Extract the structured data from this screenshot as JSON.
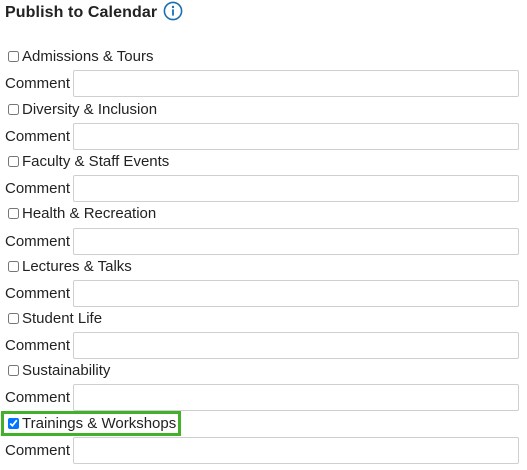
{
  "header": {
    "title": "Publish to Calendar",
    "info_icon": "info-circle-icon"
  },
  "calendars": [
    {
      "label": "Admissions & Tours",
      "checked": false,
      "comment_label": "Comment",
      "comment_value": ""
    },
    {
      "label": "Diversity & Inclusion",
      "checked": false,
      "comment_label": "Comment",
      "comment_value": ""
    },
    {
      "label": "Faculty & Staff Events",
      "checked": false,
      "comment_label": "Comment",
      "comment_value": ""
    },
    {
      "label": "Health & Recreation",
      "checked": false,
      "comment_label": "Comment",
      "comment_value": ""
    },
    {
      "label": "Lectures & Talks",
      "checked": false,
      "comment_label": "Comment",
      "comment_value": ""
    },
    {
      "label": "Student Life",
      "checked": false,
      "comment_label": "Comment",
      "comment_value": ""
    },
    {
      "label": "Sustainability",
      "checked": false,
      "comment_label": "Comment",
      "comment_value": ""
    },
    {
      "label": "Trainings & Workshops",
      "checked": true,
      "comment_label": "Comment",
      "comment_value": ""
    }
  ],
  "colors": {
    "accent": "#1a6fb0",
    "highlight": "#43b02a"
  }
}
